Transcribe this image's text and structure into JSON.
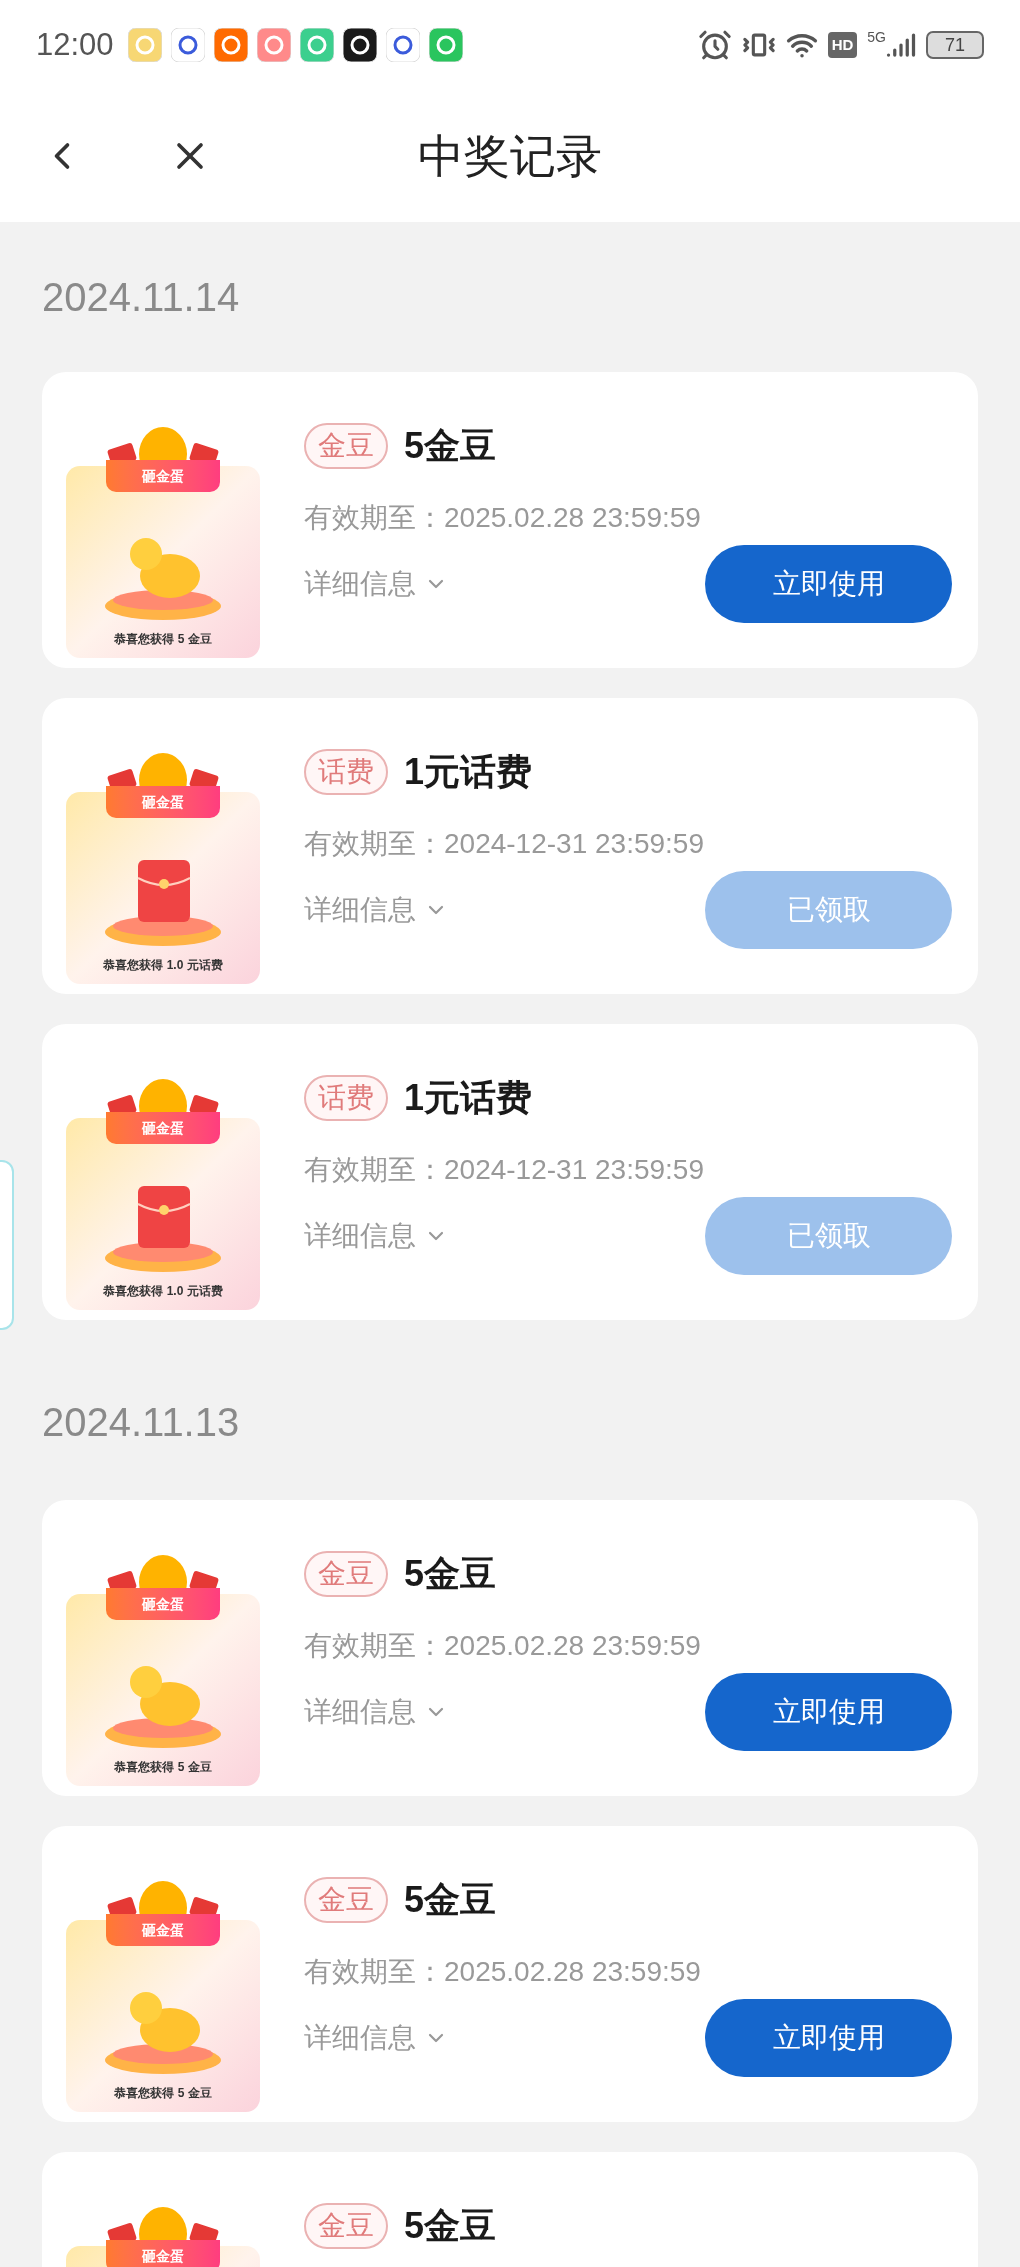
{
  "status_bar": {
    "time": "12:00",
    "hd": "HD",
    "network": "5G",
    "battery": "71"
  },
  "header": {
    "title": "中奖记录"
  },
  "groups": [
    {
      "date": "2024.11.14",
      "records": [
        {
          "tag": "金豆",
          "title": "5金豆",
          "kind": "bean",
          "banner": "砸金蛋",
          "caption": "恭喜您获得 **5** 金豆",
          "expiry": "有效期至：2025.02.28 23:59:59",
          "details": "详细信息",
          "button": {
            "label": "立即使用",
            "disabled": false
          }
        },
        {
          "tag": "话费",
          "title": "1元话费",
          "kind": "envelope",
          "banner": "砸金蛋",
          "caption": "恭喜您获得 **1.0** 元话费",
          "expiry": "有效期至：2024-12-31 23:59:59",
          "details": "详细信息",
          "button": {
            "label": "已领取",
            "disabled": true
          }
        },
        {
          "tag": "话费",
          "title": "1元话费",
          "kind": "envelope",
          "banner": "砸金蛋",
          "caption": "恭喜您获得 **1.0** 元话费",
          "expiry": "有效期至：2024-12-31 23:59:59",
          "details": "详细信息",
          "button": {
            "label": "已领取",
            "disabled": true
          }
        }
      ]
    },
    {
      "date": "2024.11.13",
      "records": [
        {
          "tag": "金豆",
          "title": "5金豆",
          "kind": "bean",
          "banner": "砸金蛋",
          "caption": "恭喜您获得 **5** 金豆",
          "expiry": "有效期至：2025.02.28 23:59:59",
          "details": "详细信息",
          "button": {
            "label": "立即使用",
            "disabled": false
          }
        },
        {
          "tag": "金豆",
          "title": "5金豆",
          "kind": "bean",
          "banner": "砸金蛋",
          "caption": "恭喜您获得 **5** 金豆",
          "expiry": "有效期至：2025.02.28 23:59:59",
          "details": "详细信息",
          "button": {
            "label": "立即使用",
            "disabled": false
          }
        },
        {
          "tag": "金豆",
          "title": "5金豆",
          "banner": "砸金蛋"
        }
      ]
    }
  ]
}
